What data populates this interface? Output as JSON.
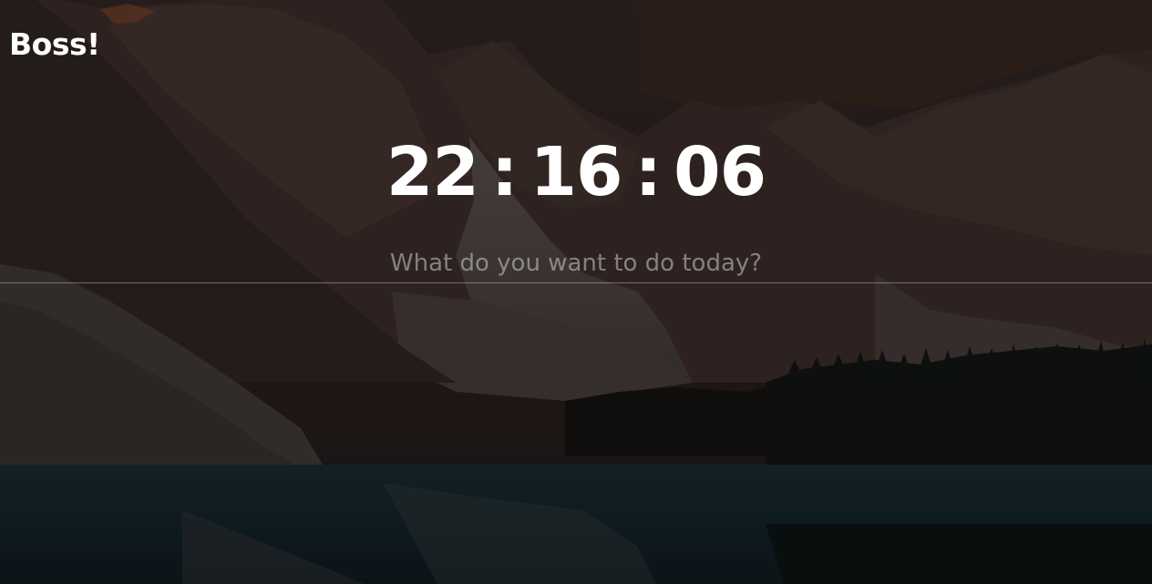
{
  "greeting": "Boss!",
  "clock": {
    "hours": "22",
    "minutes": "16",
    "seconds": "06",
    "separator": ":"
  },
  "focus_input": {
    "placeholder": "What do you want to do today?",
    "value": ""
  },
  "colors": {
    "text": "#ffffff",
    "placeholder": "#8c8886",
    "sky": "#231b19",
    "lake": "#142127"
  }
}
